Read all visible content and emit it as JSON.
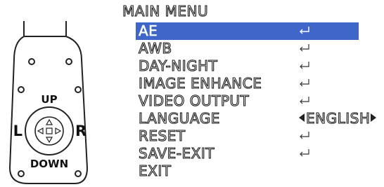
{
  "menu": {
    "title": "MAIN  MENU",
    "items": [
      {
        "label": "AE",
        "selected": true,
        "type": "enter"
      },
      {
        "label": "AWB",
        "selected": false,
        "type": "enter"
      },
      {
        "label": "DAY-NIGHT",
        "selected": false,
        "type": "enter"
      },
      {
        "label": "IMAGE ENHANCE",
        "selected": false,
        "type": "enter"
      },
      {
        "label": "VIDEO  OUTPUT",
        "selected": false,
        "type": "enter"
      },
      {
        "label": "LANGUAGE",
        "selected": false,
        "type": "option",
        "value": "ENGLISH"
      },
      {
        "label": "RESET",
        "selected": false,
        "type": "enter"
      },
      {
        "label": "SAVE-EXIT",
        "selected": false,
        "type": "enter"
      },
      {
        "label": "EXIT",
        "selected": false,
        "type": "none"
      }
    ],
    "selection_color": "#3f66c9"
  },
  "controller": {
    "up_label": "UP",
    "down_label": "DOWN",
    "left_label": "L",
    "right_label": "R",
    "icons": [
      "arrow-up-icon",
      "arrow-down-icon",
      "arrow-left-icon",
      "arrow-right-icon",
      "center-button-icon"
    ]
  }
}
